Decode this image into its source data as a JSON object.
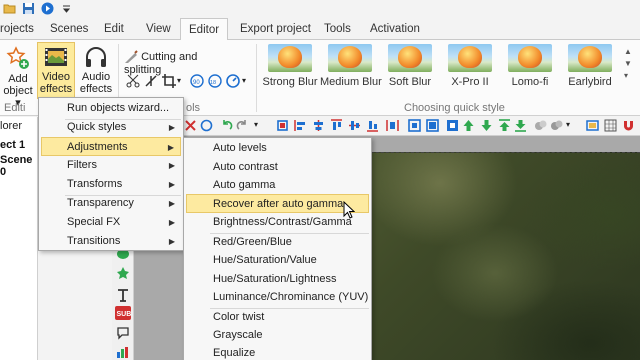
{
  "titlebar": {
    "items": [
      "folder-icon",
      "save-icon",
      "play-icon",
      "dropdown-icon"
    ]
  },
  "menubar": {
    "tabs": [
      "rojects",
      "Scenes",
      "Edit",
      "View",
      "Editor",
      "Export project",
      "Tools",
      "Activation"
    ],
    "active_tab": "Editor"
  },
  "ribbon": {
    "add_object": "Add object",
    "add_object_l1": "Add",
    "add_object_l2": "object",
    "video_effects_l1": "Video",
    "video_effects_l2": "effects",
    "audio_effects_l1": "Audio",
    "audio_effects_l2": "effects",
    "cutting": "Cutting and splitting",
    "group_edit": "Editi",
    "group_tools": "ols",
    "quick_styles_group": "Choosing quick style",
    "quick_styles": [
      "Strong Blur",
      "Medium Blur",
      "Soft Blur",
      "X-Pro II",
      "Lomo-fi",
      "Earlybird"
    ]
  },
  "left_panel": {
    "header": "lorer",
    "item1": "ect 1",
    "item2": "Scene 0"
  },
  "video_effects_menu": {
    "items": [
      {
        "label": "Run objects wizard...",
        "has_submenu": false
      },
      {
        "label": "Quick styles",
        "has_submenu": true
      },
      {
        "label": "Adjustments",
        "has_submenu": true
      },
      {
        "label": "Filters",
        "has_submenu": true
      },
      {
        "label": "Transforms",
        "has_submenu": true
      },
      {
        "label": "Transparency",
        "has_submenu": true
      },
      {
        "label": "Special FX",
        "has_submenu": true
      },
      {
        "label": "Transitions",
        "has_submenu": true
      }
    ],
    "highlighted": "Adjustments"
  },
  "adjustments_menu": {
    "items": [
      "Auto levels",
      "Auto contrast",
      "Auto gamma",
      "Recover after auto gamma",
      "Brightness/Contrast/Gamma",
      "Red/Green/Blue",
      "Hue/Saturation/Value",
      "Hue/Saturation/Lightness",
      "Luminance/Chrominance (YUV)",
      "Color twist",
      "Grayscale",
      "Equalize"
    ],
    "highlighted": "Recover after auto gamma"
  },
  "colors": {
    "highlight": "#fdeaa0",
    "accent_blue": "#1e6fd0",
    "selected_button": "#fdeb9c"
  }
}
